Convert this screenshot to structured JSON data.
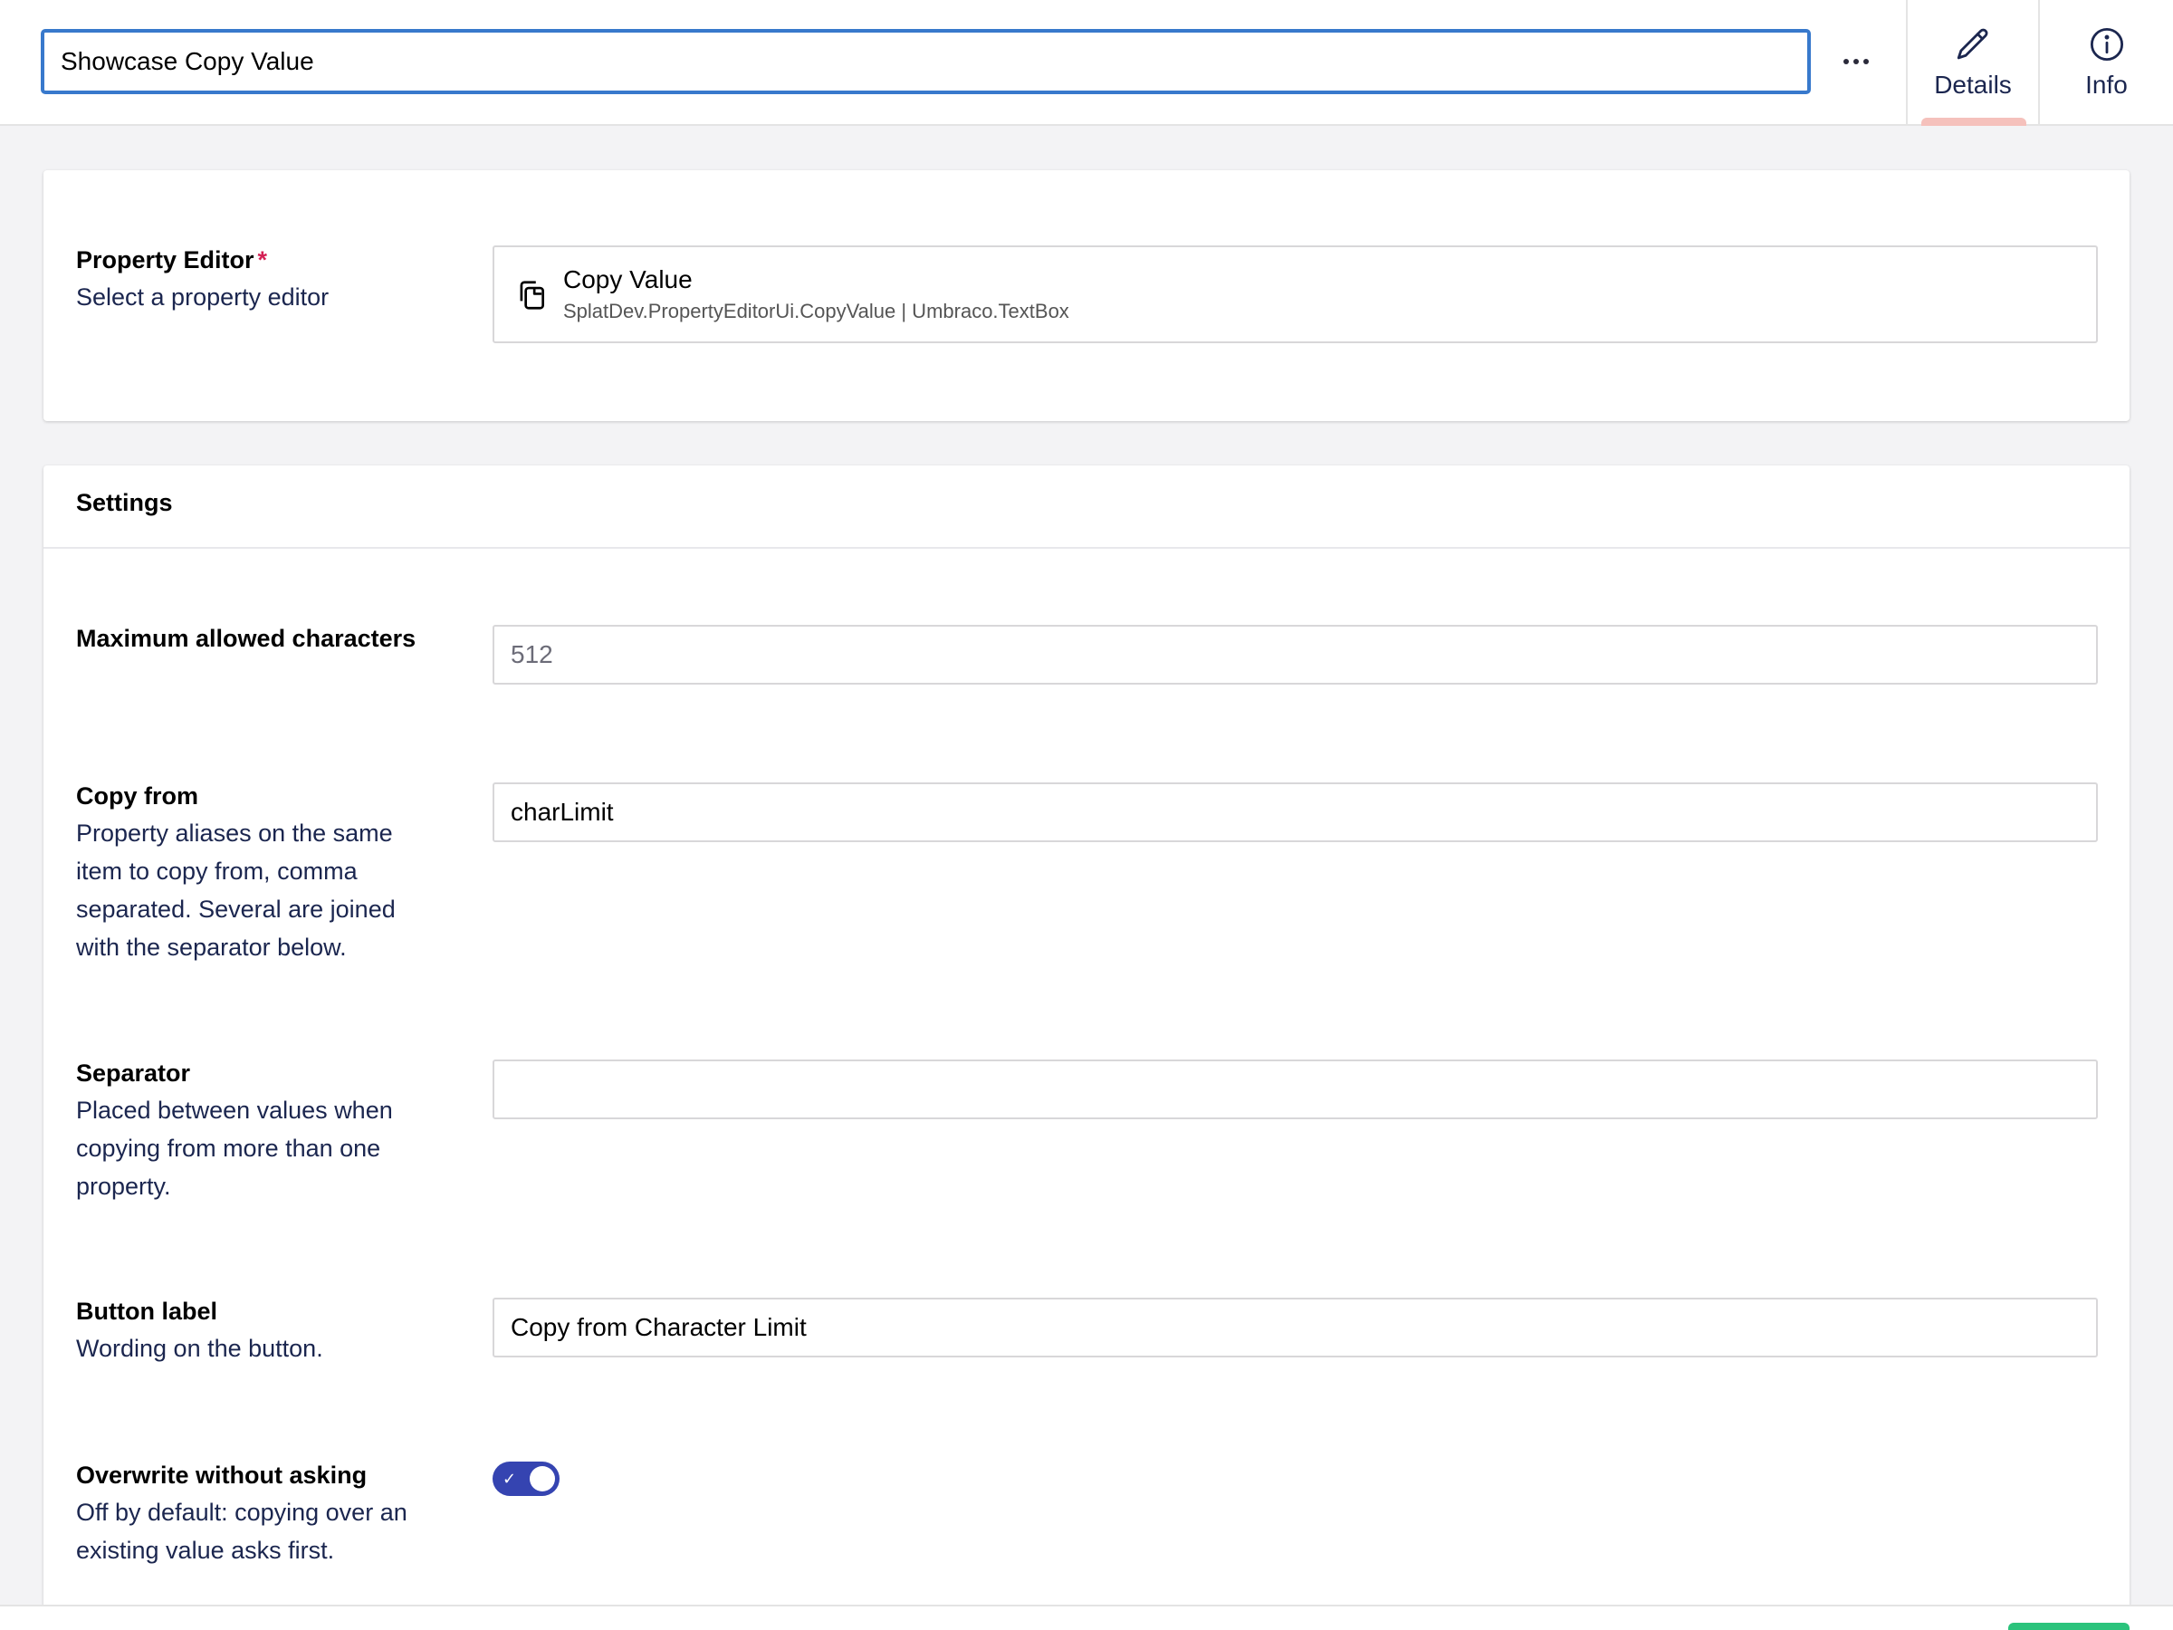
{
  "header": {
    "name_value": "Showcase Copy Value",
    "more_actions": "more-actions-icon",
    "tabs": [
      {
        "label": "Details",
        "icon": "pencil-icon",
        "active": true
      },
      {
        "label": "Info",
        "icon": "info-icon",
        "active": false
      }
    ]
  },
  "editor_card": {
    "label": "Property Editor",
    "required_marker": "*",
    "description": "Select a property editor",
    "picker": {
      "icon": "copy-icon",
      "name": "Copy Value",
      "alias": "SplatDev.PropertyEditorUi.CopyValue | Umbraco.TextBox"
    }
  },
  "settings": {
    "title": "Settings",
    "fields": [
      {
        "label": "Maximum allowed characters",
        "description": "",
        "value": "",
        "placeholder": "512"
      },
      {
        "label": "Copy from",
        "description_lines": [
          "Property aliases on the same",
          "item to copy from, comma",
          "separated. Several are joined",
          "with the separator below."
        ],
        "value": "charLimit",
        "placeholder": ""
      },
      {
        "label": "Separator",
        "description_lines": [
          "Placed between values when",
          "copying from more than one",
          "property."
        ],
        "value": "",
        "placeholder": ""
      },
      {
        "label": "Button label",
        "description": "Wording on the button.",
        "value": "Copy from Character Limit",
        "placeholder": ""
      },
      {
        "label": "Overwrite without asking",
        "description_lines": [
          "Off by default: copying over an",
          "existing value asks first."
        ],
        "toggle_on": true
      }
    ]
  },
  "colors": {
    "accent_blue": "#3879cc",
    "toggle_on": "#3544b1",
    "required": "#d42054",
    "active_tab_indicator": "#f5c1bc",
    "save_button": "#2bc37c"
  }
}
